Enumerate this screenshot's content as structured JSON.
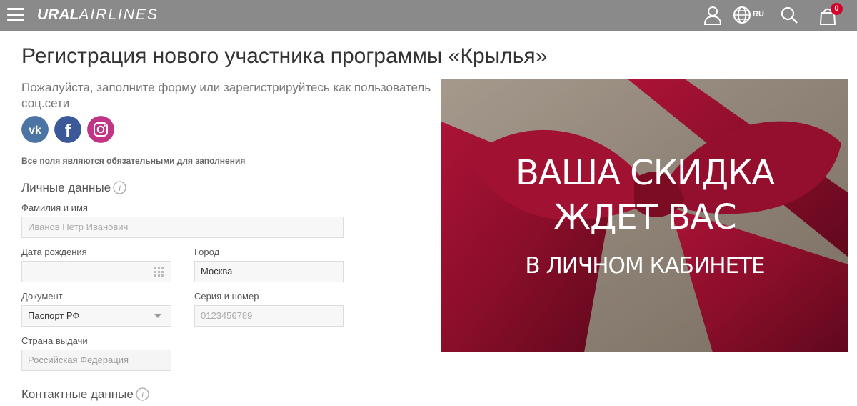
{
  "header": {
    "logo_bold": "URAL",
    "logo_light": "AIRLINES",
    "language": "RU",
    "cart_count": "0",
    "icons": [
      "menu-icon",
      "user-icon",
      "globe-icon",
      "search-icon",
      "cart-icon"
    ]
  },
  "page": {
    "title": "Регистрация нового участника программы «Крылья»",
    "subtitle": "Пожалуйста, заполните форму или зарегистрируйтесь как пользователь соц.сети",
    "social": [
      "vk-icon",
      "facebook-icon",
      "instagram-icon"
    ],
    "required_note": "Все поля являются обязательными для заполнения"
  },
  "personal": {
    "section_title": "Личные данные",
    "full_name": {
      "label": "Фамилия и имя",
      "placeholder": "Иванов Пётр Иванович"
    },
    "birth_date": {
      "label": "Дата рождения",
      "value": ""
    },
    "city": {
      "label": "Город",
      "value": "Москва"
    },
    "document": {
      "label": "Документ",
      "value": "Паспорт РФ"
    },
    "series_number": {
      "label": "Серия и номер",
      "placeholder": "0123456789"
    },
    "issue_country": {
      "label": "Страна выдачи",
      "value": "Российская Федерация"
    }
  },
  "contacts": {
    "section_title": "Контактные данные"
  },
  "promo": {
    "line1": "ВАША СКИДКА",
    "line2": "ЖДЕТ ВАС",
    "line3": "В ЛИЧНОМ КАБИНЕТЕ"
  },
  "colors": {
    "header_bg": "#8a8a8a",
    "brand_red": "#d4002a",
    "ribbon": "#9e1030",
    "vk": "#4c75a3",
    "facebook": "#3b5998",
    "instagram": "#c13584"
  }
}
